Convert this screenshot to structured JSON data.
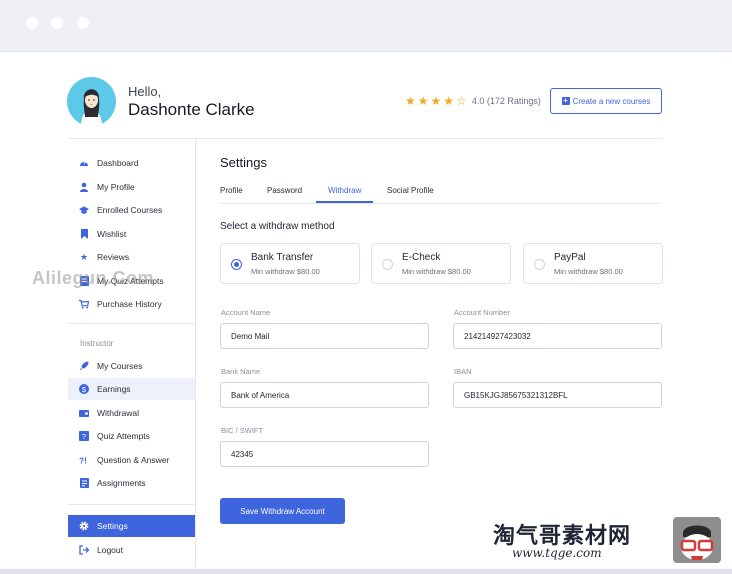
{
  "header": {
    "greeting": "Hello,",
    "user_name": "Dashonte Clarke",
    "rating_stars": 4.0,
    "rating_text": "4.0 (172 Ratings)",
    "create_button": "Create a new courses"
  },
  "sidebar": {
    "items": [
      {
        "label": "Dashboard",
        "icon": "dashboard-icon"
      },
      {
        "label": "My Profile",
        "icon": "user-icon"
      },
      {
        "label": "Enrolled Courses",
        "icon": "graduation-cap-icon"
      },
      {
        "label": "Wishlist",
        "icon": "bookmark-icon"
      },
      {
        "label": "Reviews",
        "icon": "star-icon"
      },
      {
        "label": "My Quiz Attempts",
        "icon": "quiz-icon"
      },
      {
        "label": "Purchase History",
        "icon": "cart-icon"
      }
    ],
    "instructor_label": "Instructor",
    "instructor_items": [
      {
        "label": "My Courses",
        "icon": "rocket-icon"
      },
      {
        "label": "Earnings",
        "icon": "dollar-icon"
      },
      {
        "label": "Withdrawal",
        "icon": "wallet-icon"
      },
      {
        "label": "Quiz Attempts",
        "icon": "quiz-icon"
      },
      {
        "label": "Question & Answer",
        "icon": "question-answer-icon"
      },
      {
        "label": "Assignments",
        "icon": "assignments-icon"
      }
    ],
    "settings_label": "Settings",
    "logout_label": "Logout"
  },
  "main": {
    "title": "Settings",
    "tabs": [
      "Profile",
      "Password",
      "Withdraw",
      "Social Profile"
    ],
    "active_tab": "Withdraw",
    "method_title": "Select a withdraw method",
    "methods": [
      {
        "name": "Bank Transfer",
        "min": "Min withdraw $80.00",
        "selected": true
      },
      {
        "name": "E-Check",
        "min": "Min withdraw $80.00",
        "selected": false
      },
      {
        "name": "PayPal",
        "min": "Min withdraw $80.00",
        "selected": false
      }
    ],
    "fields": {
      "account_name": {
        "label": "Account Name",
        "value": "Demo Mail"
      },
      "account_number": {
        "label": "Account Number",
        "value": "214214927423032"
      },
      "bank_name": {
        "label": "Bank Name",
        "value": "Bank of America"
      },
      "iban": {
        "label": "IBAN",
        "value": "GB15KJGJ85675321312BFL"
      },
      "bic_swift": {
        "label": "BIC / SWIFT",
        "value": "42345"
      }
    },
    "save_button": "Save Withdraw Account"
  },
  "overlays": {
    "watermark_text": "Alilegun.Com",
    "brand_text": "淘气哥素材网",
    "brand_url": "www.tqge.com"
  },
  "colors": {
    "accent": "#3e64de",
    "star": "#f5a623",
    "avatar_bg": "#5cc9e8"
  }
}
